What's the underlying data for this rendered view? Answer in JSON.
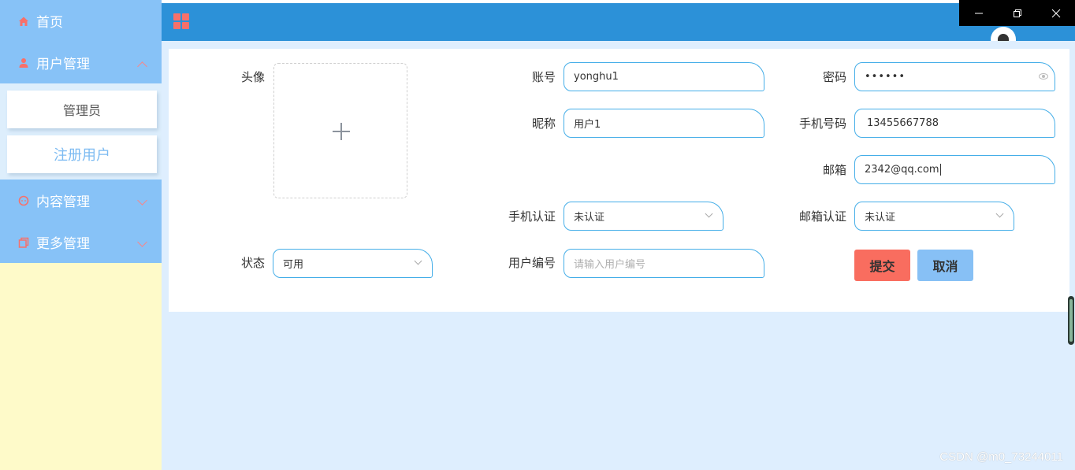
{
  "sidebar": {
    "items": [
      {
        "label": "首页",
        "icon": "home-icon"
      },
      {
        "label": "用户管理",
        "icon": "user-icon",
        "expanded": true,
        "children": [
          {
            "label": "管理员"
          },
          {
            "label": "注册用户",
            "active": true
          }
        ]
      },
      {
        "label": "内容管理",
        "icon": "chat-icon"
      },
      {
        "label": "更多管理",
        "icon": "copy-icon"
      }
    ]
  },
  "topbar": {
    "menu_icon": "grid-icon",
    "avatar": "avatar"
  },
  "window_controls": {
    "minimize": "—",
    "restore": "❐",
    "close": "✕"
  },
  "form": {
    "avatar_label": "头像",
    "account": {
      "label": "账号",
      "value": "yonghu1"
    },
    "password": {
      "label": "密码",
      "value": "••••••"
    },
    "nickname": {
      "label": "昵称",
      "value": "用户1"
    },
    "phone": {
      "label": "手机号码",
      "value": "13455667788"
    },
    "email": {
      "label": "邮箱",
      "value": "2342@qq.com"
    },
    "phone_verify": {
      "label": "手机认证",
      "value": "未认证"
    },
    "email_verify": {
      "label": "邮箱认证",
      "value": "未认证"
    },
    "status": {
      "label": "状态",
      "value": "可用"
    },
    "user_number": {
      "label": "用户编号",
      "placeholder": "请输入用户编号"
    },
    "submit_label": "提交",
    "cancel_label": "取消"
  },
  "watermark": "CSDN @m0_73244011",
  "colors": {
    "sidebar_menu": "#87c2f7",
    "sidebar_bg": "#fefac9",
    "topbar": "#2c91d8",
    "content_bg": "#deeefe",
    "accent_red": "#f96d5f",
    "accent_blue": "#87c0f5",
    "field_border": "#45aee8"
  }
}
